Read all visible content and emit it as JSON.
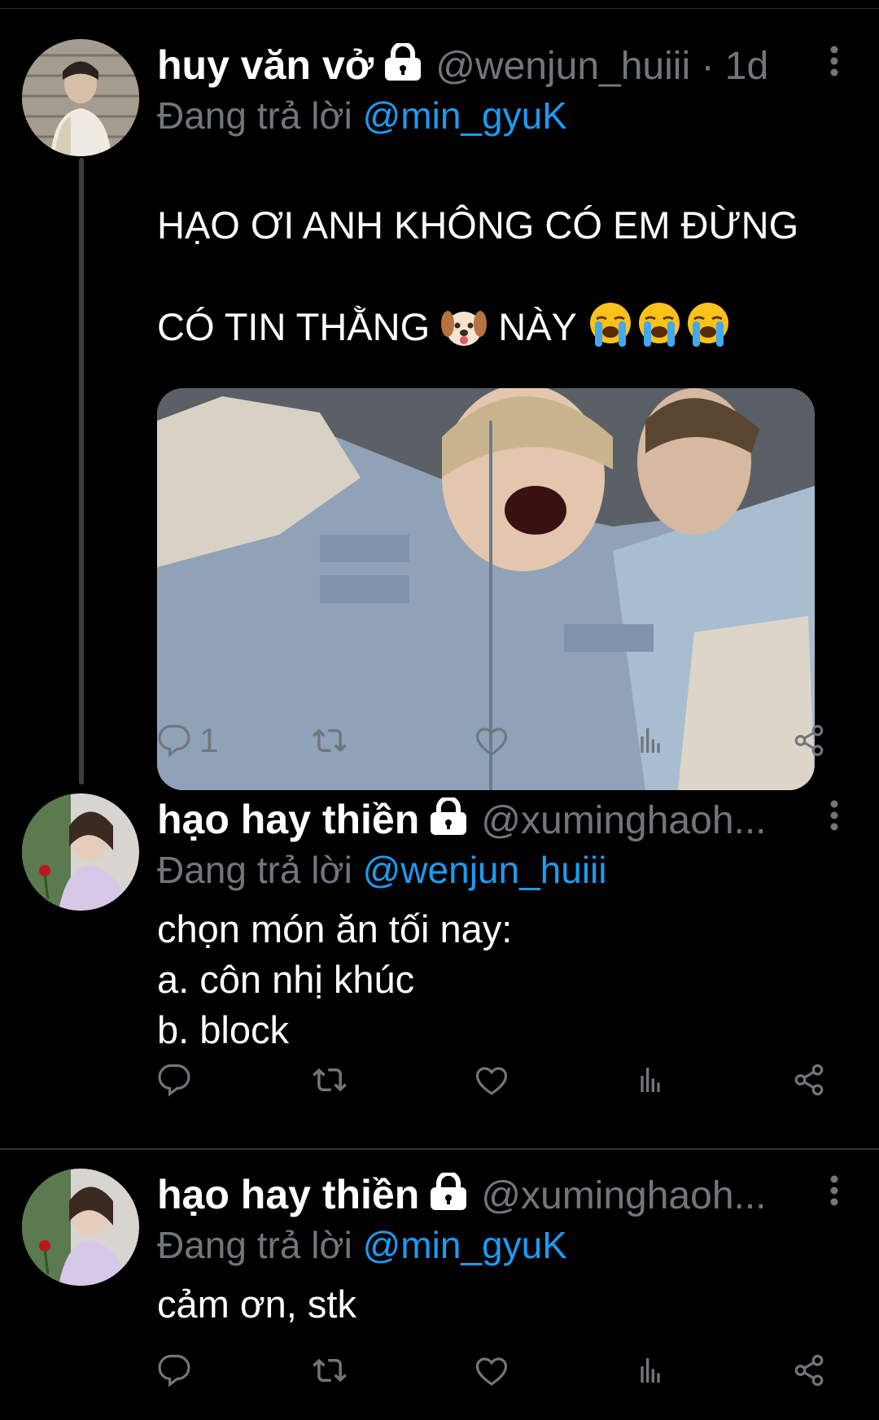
{
  "tweets": [
    {
      "name": "huy văn vở",
      "handle": "@wenjun_huiii · 1d",
      "reply_prefix": "Đang trả lời ",
      "reply_mention": "@min_gyuK",
      "text_line1": "HẠO ƠI ANH KHÔNG CÓ EM ĐỪNG",
      "text_line2a": "CÓ TIN THẰNG ",
      "text_line2b": " NÀY ",
      "reply_count": "1"
    },
    {
      "name": "hạo hay thiền",
      "handle": "@xuminghaoh...",
      "reply_prefix": "Đang trả lời ",
      "reply_mention": "@wenjun_huiii",
      "text": "chọn món ăn tối nay:\na. côn nhị khúc\nb. block"
    },
    {
      "name": "hạo hay thiền",
      "handle": "@xuminghaoh...",
      "reply_prefix": "Đang trả lời ",
      "reply_mention": "@min_gyuK",
      "text": "cảm ơn, stk"
    }
  ],
  "icons": [
    "lock-icon",
    "more-vertical-icon",
    "reply-icon",
    "retweet-icon",
    "like-icon",
    "views-icon",
    "share-icon",
    "dog-face-emoji",
    "loudly-crying-face-emoji"
  ],
  "colors": {
    "background": "#000000",
    "secondary_text": "#71767b",
    "mention": "#1d9bf0",
    "divider": "#2f3336"
  }
}
